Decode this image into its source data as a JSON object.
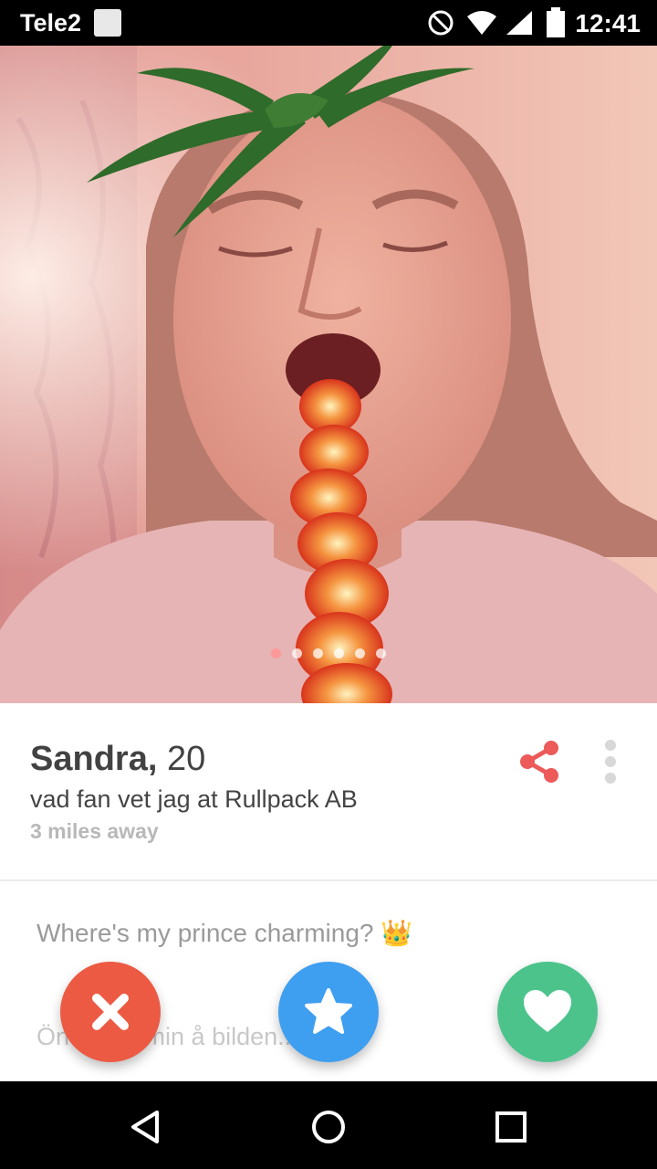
{
  "status_bar": {
    "carrier": "Tele2",
    "time": "12:41",
    "icons": [
      "sim-card-icon",
      "do-not-disturb-icon",
      "wifi-icon",
      "signal-icon",
      "battery-icon"
    ]
  },
  "photo": {
    "page_count": 6,
    "active_page": 1
  },
  "profile": {
    "name": "Sandra,",
    "age": "20",
    "job": "vad fan vet jag at Rullpack AB",
    "distance": "3 miles away"
  },
  "bio": {
    "line1": "Where's my prince charming? 👑",
    "line2": "Ön          et var min          å bilden..."
  },
  "actions": {
    "nope_icon": "close-icon",
    "superlike_icon": "star-icon",
    "like_icon": "heart-icon"
  },
  "colors": {
    "nope": "#ec5a43",
    "superlike": "#3e9ef0",
    "like": "#4cc38b",
    "share": "#ec5a5a"
  },
  "nav": {
    "icons": [
      "back-icon",
      "home-icon",
      "recents-icon"
    ]
  }
}
